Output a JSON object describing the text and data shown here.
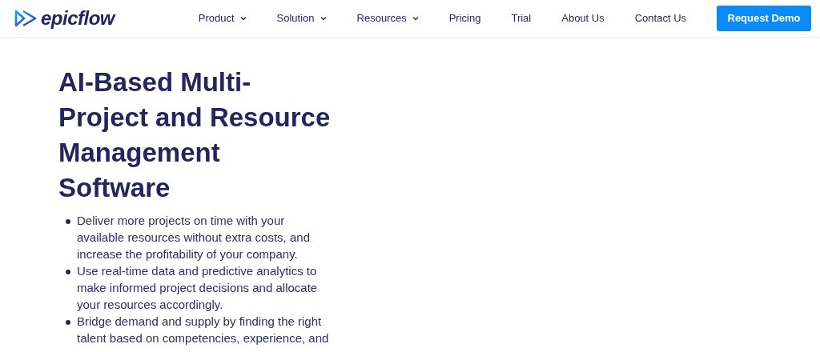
{
  "header": {
    "logo": "epicflow",
    "nav": [
      {
        "label": "Product",
        "dropdown": true
      },
      {
        "label": "Solution",
        "dropdown": true
      },
      {
        "label": "Resources",
        "dropdown": true
      },
      {
        "label": "Pricing",
        "dropdown": false
      },
      {
        "label": "Trial",
        "dropdown": false
      },
      {
        "label": "About Us",
        "dropdown": false
      },
      {
        "label": "Contact Us",
        "dropdown": false
      }
    ],
    "cta": "Request Demo"
  },
  "hero": {
    "title": "AI-Based Multi-Project and Resource Management Software",
    "bullets": [
      "Deliver more projects on time with your available resources without extra costs, and increase the profitability of your company.",
      "Use real-time data and predictive analytics to make informed project decisions and allocate your resources accordingly.",
      "Bridge demand and supply by finding the right talent based on competencies, experience, and"
    ]
  }
}
